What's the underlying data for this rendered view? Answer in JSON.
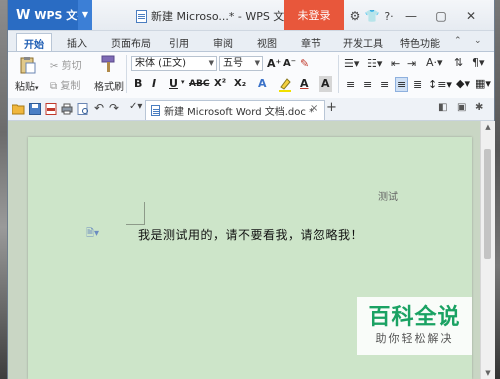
{
  "app": {
    "name": "WPS 文字",
    "title": "新建 Microso...* - WPS 文字",
    "login_label": "未登录"
  },
  "ribbon_tabs": [
    "开始",
    "插入",
    "页面布局",
    "引用",
    "审阅",
    "视图",
    "章节",
    "开发工具",
    "特色功能"
  ],
  "active_tab": "开始",
  "clipboard": {
    "paste": "粘贴",
    "cut": "剪切",
    "copy": "复制",
    "format_painter": "格式刷"
  },
  "font": {
    "family": "宋体 (正文)",
    "size": "五号",
    "grow": "A⁺",
    "shrink": "A⁻"
  },
  "format_buttons": [
    "B",
    "I",
    "U",
    "ABC",
    "X²",
    "X₂",
    "A",
    "A",
    "A"
  ],
  "quick_tab": {
    "label": "新建 Microsoft Word 文档.doc *",
    "close": "×",
    "new": "+"
  },
  "document": {
    "header_text": "测试",
    "body_text": "我是测试用的，请不要看我，请忽略我！"
  },
  "watermark": {
    "line1": "百科全说",
    "line2": "助你轻松解决"
  },
  "colors": {
    "app_blue": "#2a6cc3",
    "login_red": "#e8573b",
    "page_green": "#cde5c9",
    "watermark_green": "#1aa263"
  }
}
